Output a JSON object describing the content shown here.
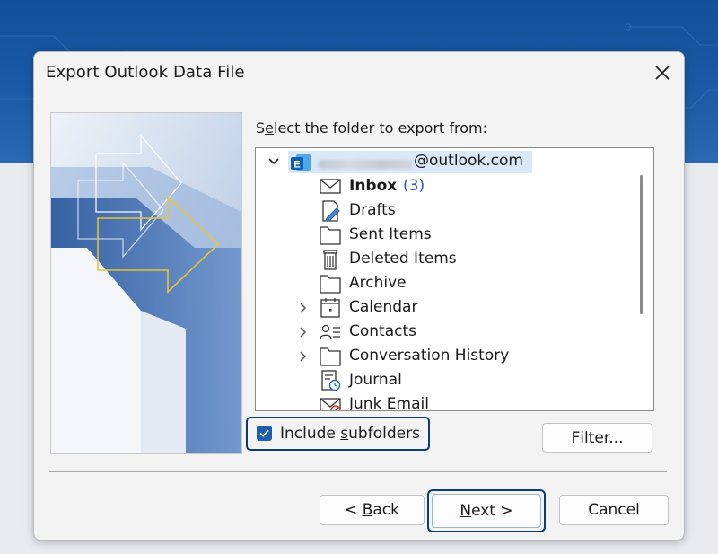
{
  "dialog": {
    "title": "Export Outlook Data File",
    "prompt_before": "S",
    "prompt_mnemonic": "e",
    "prompt_after": "lect the folder to export from:"
  },
  "tree": {
    "account_suffix": "@outlook.com",
    "items": [
      {
        "label": "Inbox",
        "count": "(3)",
        "icon": "mail-envelope-icon",
        "bold": true
      },
      {
        "label": "Drafts",
        "icon": "drafts-pencil-icon"
      },
      {
        "label": "Sent Items",
        "icon": "folder-icon"
      },
      {
        "label": "Deleted Items",
        "icon": "trash-bin-icon"
      },
      {
        "label": "Archive",
        "icon": "folder-icon"
      },
      {
        "label": "Calendar",
        "icon": "calendar-icon",
        "expandable": true
      },
      {
        "label": "Contacts",
        "icon": "contacts-icon",
        "expandable": true
      },
      {
        "label": "Conversation History",
        "icon": "folder-icon",
        "expandable": true
      },
      {
        "label": "Journal",
        "icon": "journal-icon"
      },
      {
        "label": "Junk Email",
        "icon": "junk-mail-icon"
      }
    ]
  },
  "options": {
    "include_before": "Include ",
    "include_mnemonic": "s",
    "include_after": "ubfolders",
    "include_checked": true,
    "filter_mnemonic": "F",
    "filter_after": "ilter..."
  },
  "buttons": {
    "back_before": "< ",
    "back_mnemonic": "B",
    "back_after": "ack",
    "next_mnemonic": "N",
    "next_after": "ext >",
    "cancel": "Cancel"
  },
  "colors": {
    "accent": "#1d5fae",
    "focus_border": "#0d3b73",
    "selection": "#dbe8f7",
    "inbox_count": "#2a4fd1"
  }
}
